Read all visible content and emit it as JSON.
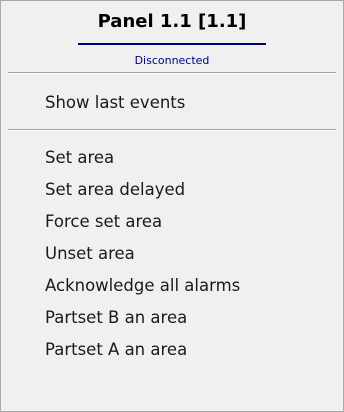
{
  "menu": {
    "title": "Panel 1.1 [1.1]",
    "status": "Disconnected",
    "status_color": "#000080",
    "items": [
      {
        "label": "Show last events"
      },
      {
        "label": "Set area"
      },
      {
        "label": "Set area delayed"
      },
      {
        "label": "Force set area"
      },
      {
        "label": "Unset area"
      },
      {
        "label": "Acknowledge all alarms"
      },
      {
        "label": "Partset B an area"
      },
      {
        "label": "Partset A an area"
      }
    ]
  }
}
